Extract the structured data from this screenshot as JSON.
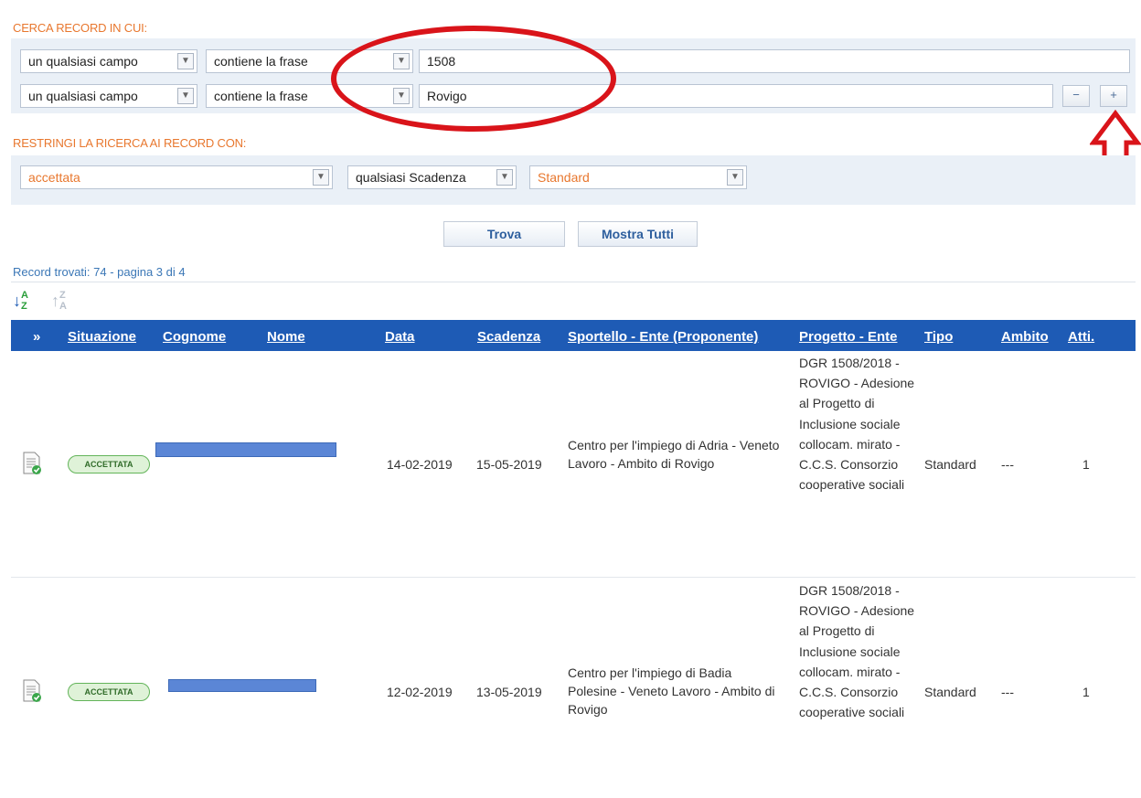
{
  "search": {
    "title": "CERCA RECORD IN CUI:",
    "rows": [
      {
        "field": "un qualsiasi campo",
        "operator": "contiene la frase",
        "value": "1508"
      },
      {
        "field": "un qualsiasi campo",
        "operator": "contiene la frase",
        "value": "Rovigo"
      }
    ],
    "remove_label": "−",
    "add_label": "+"
  },
  "restrict": {
    "title": "RESTRINGI LA RICERCA AI RECORD CON:",
    "status": "accettata",
    "deadline": "qualsiasi Scadenza",
    "type": "Standard"
  },
  "actions": {
    "find": "Trova",
    "show_all": "Mostra Tutti"
  },
  "results": {
    "summary": "Record trovati: 74 - pagina 3 di 4"
  },
  "sort": {
    "asc": "AZ",
    "desc": "ZA"
  },
  "table": {
    "expand_symbol": "»",
    "columns": [
      "Situazione",
      "Cognome",
      "Nome",
      "Data",
      "Scadenza",
      "Sportello - Ente (Proponente)",
      "Progetto - Ente",
      "Tipo",
      "Ambito",
      "Atti."
    ],
    "rows": [
      {
        "status": "ACCETTATA",
        "data": "14-02-2019",
        "scadenza": "15-05-2019",
        "sportello": "Centro per l'impiego di Adria - Veneto Lavoro - Ambito di Rovigo",
        "progetto": "DGR 1508/2018 - ROVIGO - Adesione al Progetto di Inclusione sociale collocam. mirato - C.C.S. Consorzio cooperative sociali",
        "tipo": "Standard",
        "ambito": "---",
        "atti": "1"
      },
      {
        "status": "ACCETTATA",
        "data": "12-02-2019",
        "scadenza": "13-05-2019",
        "sportello": "Centro per l'impiego di Badia Polesine - Veneto Lavoro - Ambito di Rovigo",
        "progetto": "DGR 1508/2018 - ROVIGO - Adesione al Progetto di Inclusione sociale collocam. mirato - C.C.S. Consorzio cooperative sociali",
        "tipo": "Standard",
        "ambito": "---",
        "atti": "1"
      }
    ]
  },
  "colors": {
    "header_blue": "#1e5bb5",
    "label_orange": "#e8772e",
    "annotation_red": "#d9141a",
    "badge_green": "#63b45a"
  }
}
